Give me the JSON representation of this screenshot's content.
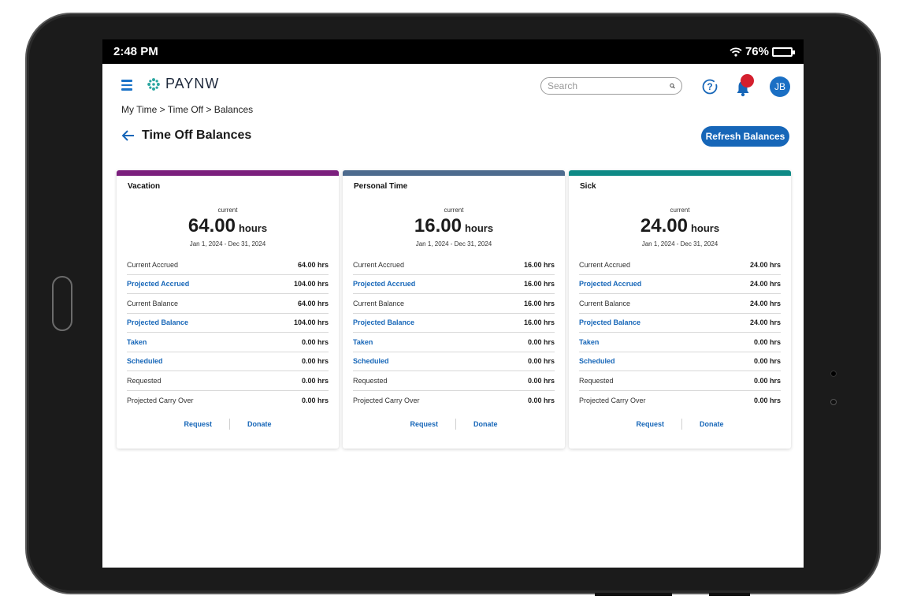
{
  "status_bar": {
    "time": "2:48 PM",
    "battery": "76%",
    "battery_level": 0.76
  },
  "app": {
    "logo_text": "PAYNW",
    "search_placeholder": "Search",
    "avatar_initials": "JB",
    "colors": {
      "primary": "#1666b8",
      "logo_teal": "#2aa6a0",
      "notification": "#d41f2e"
    }
  },
  "breadcrumb": "My Time > Time Off > Balances",
  "page": {
    "title": "Time Off Balances",
    "refresh_label": "Refresh Balances"
  },
  "cards": [
    {
      "title": "Vacation",
      "accent": "#7b1f7d",
      "current_label": "current",
      "hours": "64.00",
      "unit": "hours",
      "date_range": "Jan 1, 2024 - Dec 31, 2024",
      "rows": [
        {
          "label": "Current Accrued",
          "value": "64.00 hrs"
        },
        {
          "label": "Projected Accrued",
          "value": "104.00 hrs"
        },
        {
          "label": "Current Balance",
          "value": "64.00 hrs"
        },
        {
          "label": "Projected Balance",
          "value": "104.00 hrs"
        },
        {
          "label": "Taken",
          "value": "0.00 hrs"
        },
        {
          "label": "Scheduled",
          "value": "0.00 hrs"
        },
        {
          "label": "Requested",
          "value": "0.00 hrs"
        },
        {
          "label": "Projected Carry Over",
          "value": "0.00 hrs"
        }
      ],
      "actions": {
        "request": "Request",
        "donate": "Donate"
      }
    },
    {
      "title": "Personal Time",
      "accent": "#4d6b8e",
      "current_label": "current",
      "hours": "16.00",
      "unit": "hours",
      "date_range": "Jan 1, 2024 - Dec 31, 2024",
      "rows": [
        {
          "label": "Current Accrued",
          "value": "16.00 hrs"
        },
        {
          "label": "Projected Accrued",
          "value": "16.00 hrs"
        },
        {
          "label": "Current Balance",
          "value": "16.00 hrs"
        },
        {
          "label": "Projected Balance",
          "value": "16.00 hrs"
        },
        {
          "label": "Taken",
          "value": "0.00 hrs"
        },
        {
          "label": "Scheduled",
          "value": "0.00 hrs"
        },
        {
          "label": "Requested",
          "value": "0.00 hrs"
        },
        {
          "label": "Projected Carry Over",
          "value": "0.00 hrs"
        }
      ],
      "actions": {
        "request": "Request",
        "donate": "Donate"
      }
    },
    {
      "title": "Sick",
      "accent": "#0e8a86",
      "current_label": "current",
      "hours": "24.00",
      "unit": "hours",
      "date_range": "Jan 1, 2024 - Dec 31, 2024",
      "rows": [
        {
          "label": "Current Accrued",
          "value": "24.00 hrs"
        },
        {
          "label": "Projected Accrued",
          "value": "24.00 hrs"
        },
        {
          "label": "Current Balance",
          "value": "24.00 hrs"
        },
        {
          "label": "Projected Balance",
          "value": "24.00 hrs"
        },
        {
          "label": "Taken",
          "value": "0.00 hrs"
        },
        {
          "label": "Scheduled",
          "value": "0.00 hrs"
        },
        {
          "label": "Requested",
          "value": "0.00 hrs"
        },
        {
          "label": "Projected Carry Over",
          "value": "0.00 hrs"
        }
      ],
      "actions": {
        "request": "Request",
        "donate": "Donate"
      }
    }
  ]
}
